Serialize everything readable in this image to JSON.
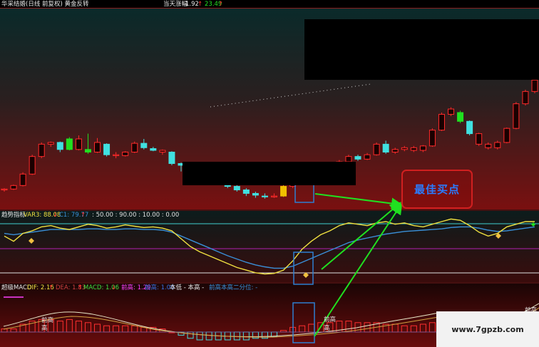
{
  "header": {
    "title": "华采结婚(日线 前复权) 黄金反转",
    "change_label": "当天涨幅",
    "change_value": "1.92",
    "price": "23.49"
  },
  "trend_panel": {
    "name": "趋势指标",
    "var3": "VAR3: 88.08",
    "c1": "C1: 79.77",
    "levels": ": 50.00 : 90.00 : 10.00 : 0.00"
  },
  "macd_panel": {
    "name": "超级MACD",
    "dif": "DIF: 2.16",
    "dea": "DEA: 1.83",
    "macd": "MACD: 1.06",
    "prev_high": "前高: 1.29",
    "prev_high2": "前高: 1.00",
    "low_high": "本低 - 本高 -",
    "ratio": "前高本高二分位: -",
    "tag_prev_high": "前高",
    "tag_high": "高"
  },
  "annotation": {
    "buy_point": "最佳买点"
  },
  "watermark": "www.7gpzb.com",
  "colors": {
    "up": "#ff2a2a",
    "down": "#40e0e0",
    "var3": "#f0e040",
    "c1": "#3a8fd8",
    "arrow": "#20e020",
    "box": "#2f7fd0",
    "magenta": "#ff40ff"
  },
  "candles": [
    [
      21.0,
      21.1,
      20.8,
      21.2,
      "u"
    ],
    [
      21.1,
      21.5,
      21.0,
      21.6,
      "u"
    ],
    [
      21.5,
      22.8,
      21.4,
      23.0,
      "u"
    ],
    [
      22.8,
      24.8,
      22.7,
      25.0,
      "u"
    ],
    [
      24.8,
      26.2,
      24.6,
      26.4,
      "u"
    ],
    [
      26.2,
      26.4,
      25.9,
      26.5,
      "u"
    ],
    [
      26.4,
      25.6,
      25.3,
      26.5,
      "d"
    ],
    [
      25.6,
      26.8,
      25.5,
      27.0,
      "g"
    ],
    [
      26.8,
      25.6,
      25.5,
      27.2,
      "u"
    ],
    [
      25.6,
      25.3,
      25.1,
      27.4,
      "g"
    ],
    [
      25.3,
      26.4,
      25.2,
      26.9,
      "u"
    ],
    [
      26.2,
      25.0,
      24.8,
      26.3,
      "d"
    ],
    [
      25.0,
      24.9,
      24.6,
      25.3,
      "u"
    ],
    [
      24.9,
      25.3,
      24.8,
      25.4,
      "u"
    ],
    [
      25.3,
      26.3,
      25.2,
      26.5,
      "u"
    ],
    [
      26.3,
      25.8,
      25.6,
      26.8,
      "d"
    ],
    [
      25.7,
      25.5,
      25.4,
      25.9,
      "d"
    ],
    [
      25.5,
      25.3,
      25.0,
      25.6,
      "u"
    ],
    [
      25.3,
      24.0,
      23.8,
      25.4,
      "d"
    ],
    [
      24.0,
      23.8,
      23.1,
      24.1,
      "d"
    ],
    [
      23.8,
      23.4,
      23.2,
      24.0,
      "d"
    ],
    [
      23.4,
      23.0,
      22.9,
      23.6,
      "d"
    ],
    [
      23.0,
      22.5,
      22.3,
      23.1,
      "d"
    ],
    [
      22.5,
      22.0,
      21.8,
      22.6,
      "d"
    ],
    [
      22.0,
      21.4,
      21.2,
      22.1,
      "d"
    ],
    [
      21.4,
      21.0,
      20.8,
      21.6,
      "d"
    ],
    [
      21.0,
      20.6,
      20.3,
      21.2,
      "d"
    ],
    [
      20.6,
      20.4,
      20.1,
      20.8,
      "d"
    ],
    [
      20.3,
      20.2,
      20.0,
      20.6,
      "d"
    ],
    [
      20.2,
      20.3,
      20.1,
      20.6,
      "u"
    ],
    [
      20.3,
      21.4,
      20.2,
      21.6,
      "y"
    ],
    [
      21.4,
      22.0,
      21.2,
      22.2,
      "u"
    ],
    [
      22.0,
      22.3,
      21.9,
      22.5,
      "u"
    ],
    [
      22.3,
      22.8,
      22.1,
      23.0,
      "u"
    ],
    [
      22.8,
      23.2,
      22.6,
      23.4,
      "u"
    ],
    [
      23.2,
      23.6,
      23.0,
      23.8,
      "u"
    ],
    [
      23.6,
      24.2,
      23.4,
      24.4,
      "u"
    ],
    [
      24.2,
      24.8,
      24.0,
      25.0,
      "u"
    ],
    [
      24.8,
      24.5,
      24.3,
      25.0,
      "d"
    ],
    [
      24.5,
      25.0,
      24.4,
      25.2,
      "u"
    ],
    [
      25.0,
      26.2,
      24.9,
      26.4,
      "u"
    ],
    [
      26.2,
      25.3,
      25.1,
      26.6,
      "d"
    ],
    [
      25.3,
      25.6,
      25.1,
      25.8,
      "u"
    ],
    [
      25.6,
      25.8,
      25.4,
      26.0,
      "u"
    ],
    [
      25.8,
      25.5,
      25.3,
      26.0,
      "u"
    ],
    [
      25.5,
      26.0,
      25.3,
      26.1,
      "u"
    ],
    [
      26.0,
      27.8,
      25.9,
      28.0,
      "u"
    ],
    [
      27.8,
      29.6,
      27.7,
      29.8,
      "u"
    ],
    [
      29.6,
      30.2,
      29.4,
      30.4,
      "u"
    ],
    [
      29.8,
      28.8,
      28.6,
      30.0,
      "g"
    ],
    [
      28.8,
      27.4,
      27.2,
      28.9,
      "d"
    ],
    [
      27.4,
      26.2,
      26.0,
      27.5,
      "u"
    ],
    [
      26.2,
      25.8,
      25.6,
      26.4,
      "u"
    ],
    [
      25.8,
      26.4,
      25.6,
      26.6,
      "u"
    ],
    [
      26.4,
      28.0,
      26.3,
      28.1,
      "u"
    ],
    [
      28.0,
      30.8,
      27.9,
      31.0,
      "u"
    ],
    [
      30.8,
      32.2,
      30.6,
      32.4,
      "u"
    ],
    [
      32.2,
      33.5,
      32.0,
      33.8,
      "u"
    ]
  ],
  "var3_line": [
    66,
    58,
    70,
    74,
    80,
    82,
    78,
    76,
    80,
    84,
    82,
    78,
    80,
    83,
    81,
    79,
    80,
    78,
    74,
    62,
    50,
    42,
    36,
    30,
    24,
    18,
    14,
    10,
    8,
    9,
    14,
    28,
    46,
    58,
    68,
    74,
    82,
    86,
    84,
    82,
    86,
    88,
    84,
    86,
    82,
    80,
    84,
    88,
    92,
    90,
    82,
    72,
    66,
    70,
    80,
    84,
    88,
    88
  ],
  "c1_line": [
    70,
    68,
    70,
    72,
    74,
    76,
    76,
    76,
    76,
    77,
    77,
    76,
    76,
    77,
    77,
    76,
    76,
    75,
    72,
    66,
    60,
    54,
    48,
    42,
    36,
    31,
    26,
    22,
    19,
    17,
    17,
    20,
    26,
    32,
    38,
    44,
    50,
    56,
    60,
    63,
    66,
    69,
    71,
    73,
    74,
    75,
    76,
    77,
    79,
    80,
    80,
    78,
    75,
    73,
    74,
    76,
    78,
    80
  ],
  "macd_hist": [
    0.2,
    0.2,
    0.5,
    0.7,
    0.8,
    0.8,
    0.7,
    0.8,
    0.7,
    0.6,
    0.5,
    0.4,
    0.4,
    0.4,
    0.4,
    0.3,
    0.3,
    0.2,
    0.0,
    -0.2,
    -0.4,
    -0.5,
    -0.5,
    -0.5,
    -0.5,
    -0.5,
    -0.5,
    -0.4,
    -0.4,
    -0.3,
    0.1,
    0.3,
    0.4,
    0.5,
    0.6,
    0.6,
    0.7,
    0.7,
    0.6,
    0.6,
    0.6,
    0.5,
    0.5,
    0.4,
    0.4,
    0.5,
    0.6,
    0.8,
    0.8,
    0.6,
    0.4,
    0.2,
    0.1,
    0.1,
    0.3,
    0.6,
    0.9,
    1.06
  ]
}
